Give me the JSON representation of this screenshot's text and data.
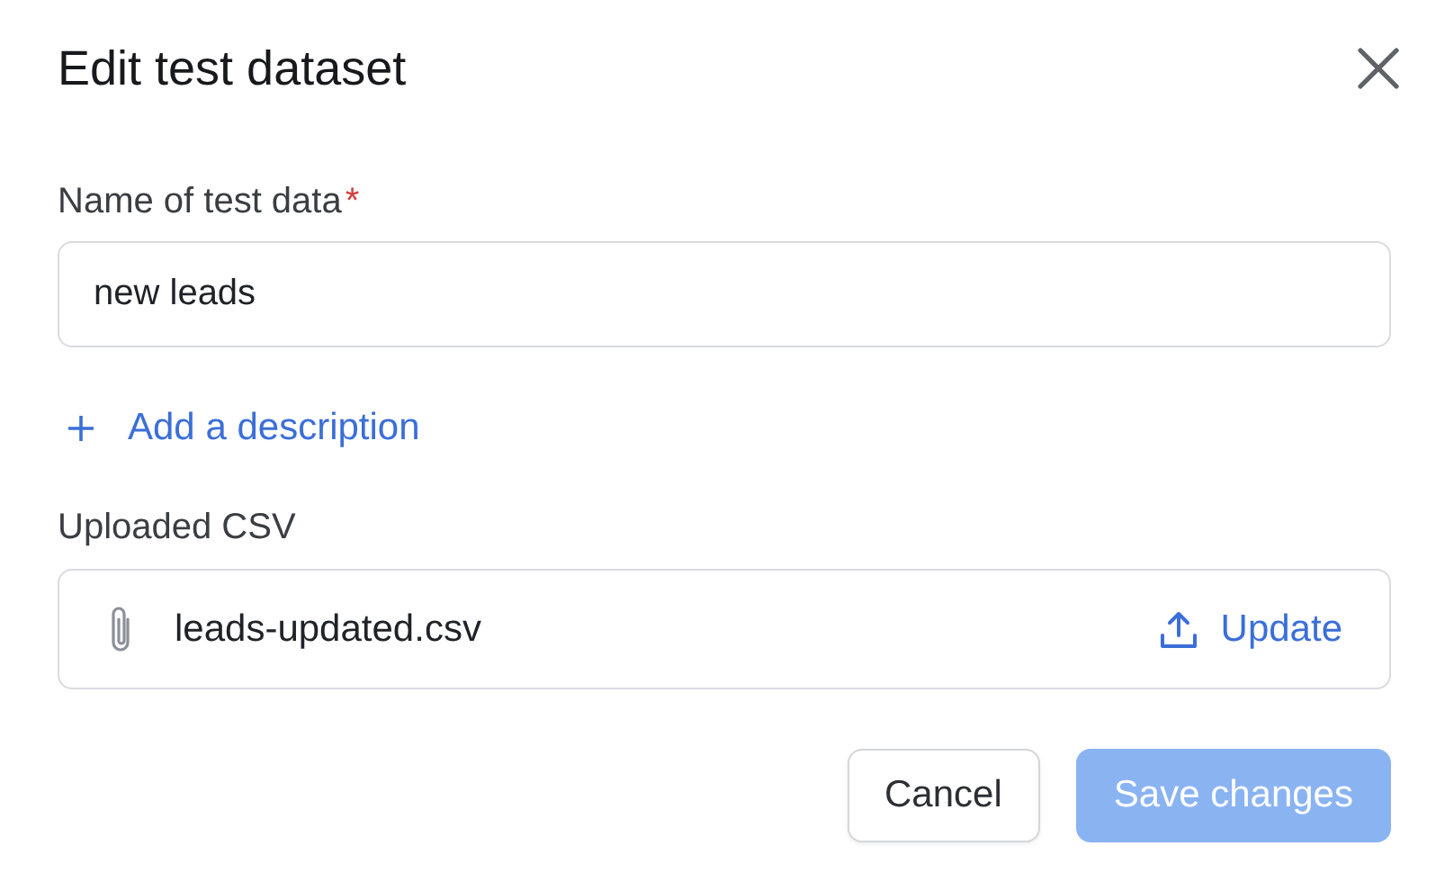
{
  "dialog": {
    "title": "Edit test dataset"
  },
  "name_field": {
    "label": "Name of test data",
    "required": true,
    "required_mark": "*",
    "value": "new leads"
  },
  "add_description": {
    "label": "Add a description"
  },
  "upload": {
    "label": "Uploaded CSV",
    "file_name": "leads-updated.csv",
    "action": "Update"
  },
  "buttons": [
    {
      "label": "Cancel",
      "kind": "secondary",
      "disabled": false
    },
    {
      "label": "Save changes",
      "kind": "primary",
      "disabled": true
    }
  ]
}
